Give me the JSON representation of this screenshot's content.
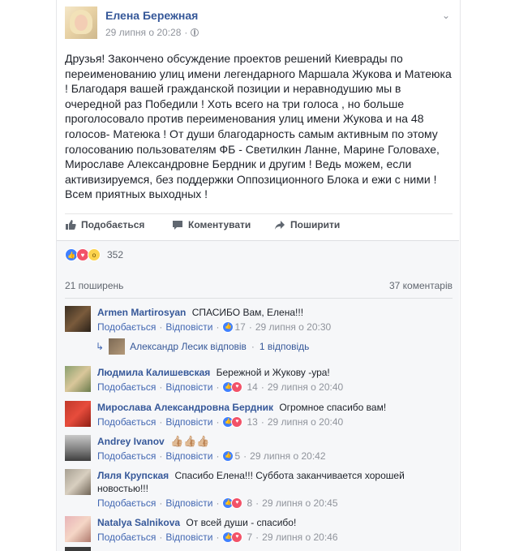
{
  "post": {
    "author": "Елена Бережная",
    "timestamp": "29 липня о 20:28",
    "separator": "·",
    "chevron": "⌄",
    "text": "Друзья! Закончено обсуждение проектов решений Киеврады по переименованию улиц имени легендарного Маршала Жукова и Матеюка ! Благодаря вашей гражданской позиции и неравнодушию мы в очередной раз Победили ! Хоть всего на три голоса , но больше проголосовало против переименования улиц имени Жукова и на 48 голосов- Матеюка ! От души благодарность самым активным по этому голосованию пользователям ФБ - Светилкин Ланне, Марине Головахе, Мирославе Александровне Бердник и другим ! Ведь можем, если активизируемся, без поддержки Оппозиционного Блока и ежи с ними ! Всем приятных выходных !"
  },
  "actions": {
    "like": "Подобається",
    "comment": "Коментувати",
    "share": "Поширити"
  },
  "stats": {
    "reactions_count": "352",
    "shares": "21 поширень",
    "comments": "37 коментарів"
  },
  "comment_labels": {
    "like": "Подобається",
    "reply": "Відповісти",
    "dot": "·"
  },
  "comments": [
    {
      "author": "Armen Martirosyan",
      "text": "СПАСИБО Вам, Елена!!!",
      "reactions": "17",
      "time": "29 липня о 20:30"
    },
    {
      "author": "Людмила Калишевская",
      "text": "Бережной и Жукову -ура!",
      "reactions": "14",
      "time": "29 липня о 20:40"
    },
    {
      "author": "Мирослава Александровна Бердник",
      "text": "Огромное спасибо вам!",
      "reactions": "13",
      "time": "29 липня о 20:40"
    },
    {
      "author": "Andrey Ivanov",
      "text": "👍🏼👍🏼👍🏼",
      "reactions": "5",
      "time": "29 липня о 20:42"
    },
    {
      "author": "Ляля Крупская",
      "text": "Спасибо Елена!!! Суббота заканчивается хорошей новостью!!!",
      "reactions": "8",
      "time": "29 липня о 20:45"
    },
    {
      "author": "Natalya Salnikova",
      "text": "От всей души - спасибо!",
      "reactions": "7",
      "time": "29 липня о 20:46"
    }
  ],
  "reply_row": {
    "replier": "Александр Лесик відповів",
    "dot": "·",
    "count": "1 відповідь"
  }
}
